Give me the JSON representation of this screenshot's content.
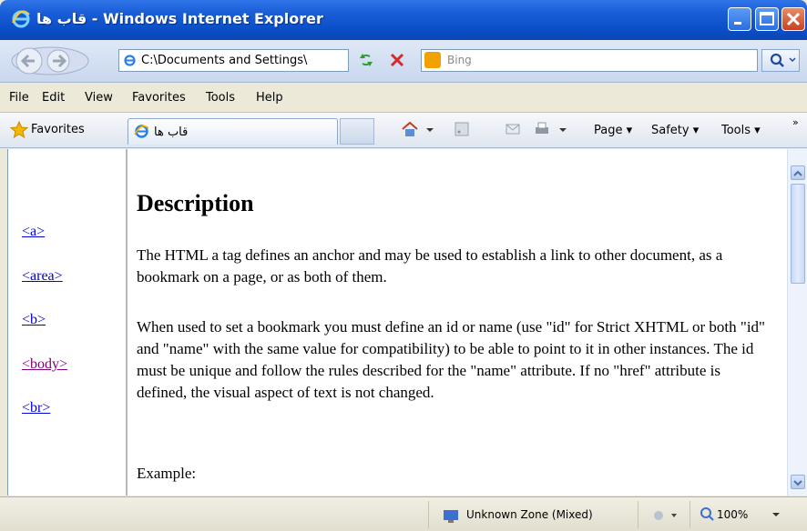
{
  "window": {
    "title_rtl_part": "قاب ها",
    "title_suffix": " - Windows Internet Explorer"
  },
  "address_bar": {
    "value": "C:\\Documents and Settings\\",
    "search_placeholder": "Bing"
  },
  "menu": [
    "File",
    "Edit",
    "View",
    "Favorites",
    "Tools",
    "Help"
  ],
  "favorites_bar": {
    "favorites_label": "Favorites",
    "tab_title": "قاب ها",
    "commands": [
      "Page",
      "Safety",
      "Tools"
    ]
  },
  "left_frame": {
    "links": [
      "<a>",
      "<area>",
      "<b>",
      "<body>",
      "<br>"
    ]
  },
  "main_frame": {
    "heading": "Description",
    "paragraphs": [
      "The HTML a tag defines an anchor and may be used to establish a link to other document, as a bookmark on a page, or as both of them.",
      "When used to set a bookmark you must define an id or name (use \"id\" for Strict XHTML or both \"id\" and \"name\" with the same value for compatibility) to be able to point to it in other instances. The id must be unique and follow the rules described for the \"name\" attribute. If no \"href\" attribute is defined, the visual aspect of text is not changed.",
      "Example:"
    ]
  },
  "status_bar": {
    "zone": "Unknown Zone (Mixed)",
    "zoom": "100%"
  },
  "colors": {
    "titlebar": "#0b4fc9",
    "link": "#0000d8",
    "visited_link": "#800080"
  }
}
